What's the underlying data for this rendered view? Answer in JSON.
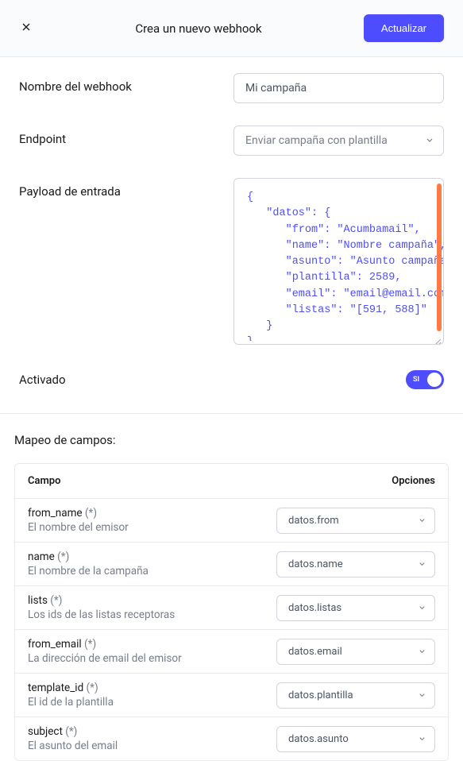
{
  "header": {
    "title": "Crea un nuevo webhook",
    "update_label": "Actualizar"
  },
  "form": {
    "name_label": "Nombre del webhook",
    "name_value": "Mi campaña",
    "endpoint_label": "Endpoint",
    "endpoint_value": "Enviar campaña con plantilla",
    "payload_label": "Payload de entrada",
    "payload_value": "{\n   \"datos\": {\n      \"from\": \"Acumbamail\",\n      \"name\": \"Nombre campaña\",\n      \"asunto\": \"Asunto campaña\",\n      \"plantilla\": 2589,\n      \"email\": \"email@email.com\",\n      \"listas\": \"[591, 588]\"\n   }\n}",
    "activado_label": "Activado",
    "toggle_text": "SI"
  },
  "mapping": {
    "title": "Mapeo de campos:",
    "header_field": "Campo",
    "header_options": "Opciones",
    "required_marker": "(*)",
    "rows": [
      {
        "name": "from_name",
        "desc": "El nombre del emisor",
        "option": "datos.from"
      },
      {
        "name": "name",
        "desc": "El nombre de la campaña",
        "option": "datos.name"
      },
      {
        "name": "lists",
        "desc": "Los ids de las listas receptoras",
        "option": "datos.listas"
      },
      {
        "name": "from_email",
        "desc": "La dirección de email del emisor",
        "option": "datos.email"
      },
      {
        "name": "template_id",
        "desc": "El id de la plantilla",
        "option": "datos.plantilla"
      },
      {
        "name": "subject",
        "desc": "El asunto del email",
        "option": "datos.asunto"
      }
    ]
  }
}
